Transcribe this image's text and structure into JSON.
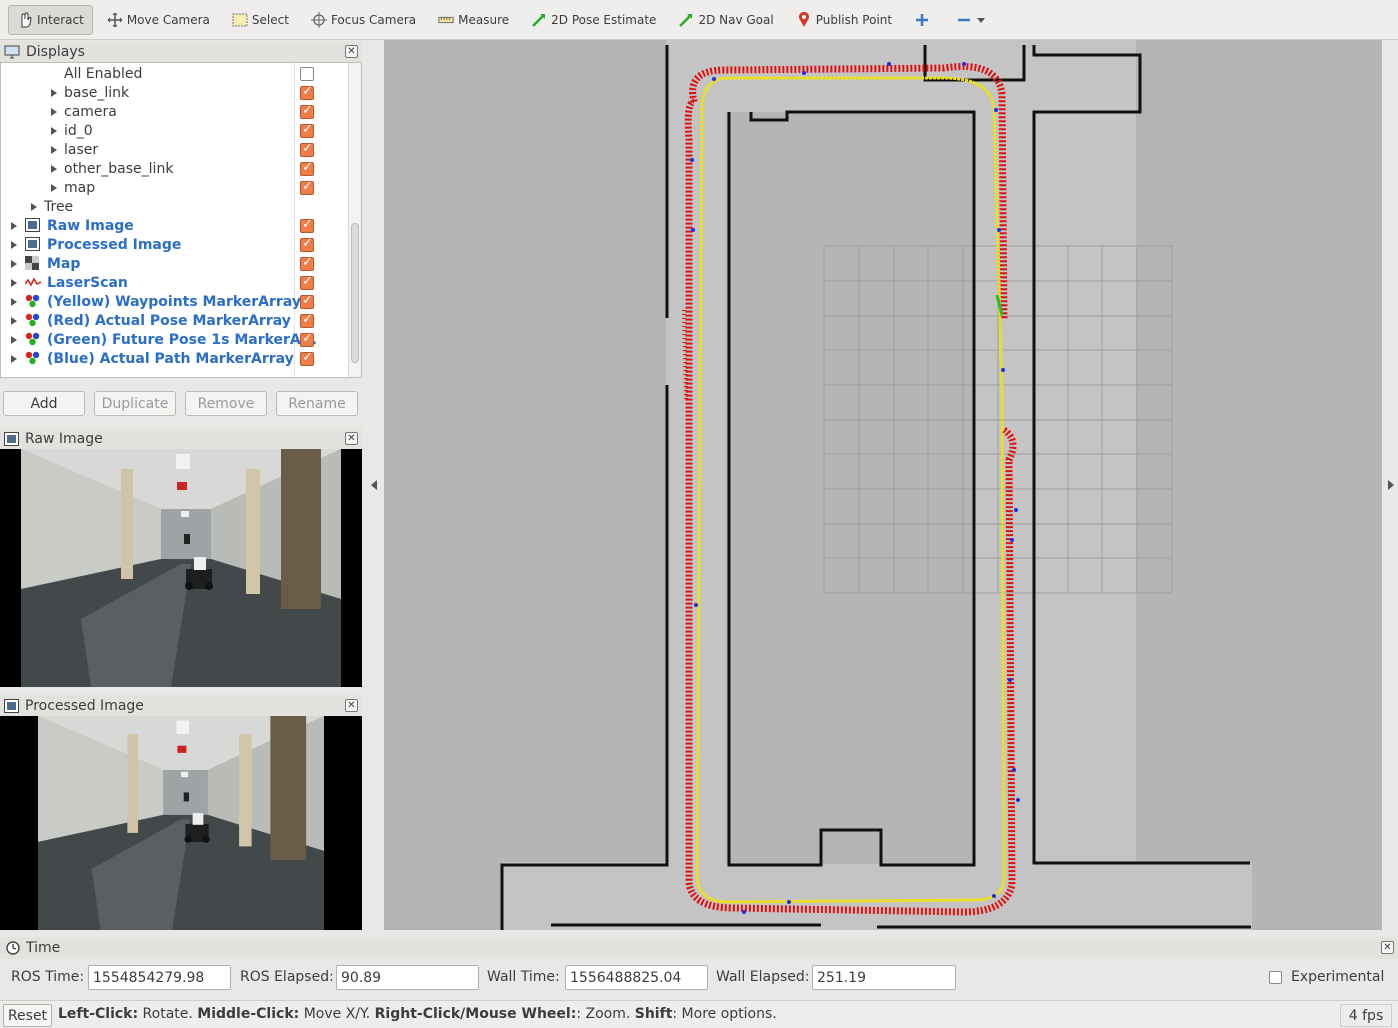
{
  "toolbar": {
    "interact": "Interact",
    "move_camera": "Move Camera",
    "select": "Select",
    "focus_camera": "Focus Camera",
    "measure": "Measure",
    "pose_estimate": "2D Pose Estimate",
    "nav_goal": "2D Nav Goal",
    "publish_point": "Publish Point"
  },
  "displays": {
    "title": "Displays",
    "items": [
      {
        "label": "All Enabled",
        "checked": false
      },
      {
        "label": "base_link",
        "checked": true
      },
      {
        "label": "camera",
        "checked": true
      },
      {
        "label": "id_0",
        "checked": true
      },
      {
        "label": "laser",
        "checked": true
      },
      {
        "label": "other_base_link",
        "checked": true
      },
      {
        "label": "map",
        "checked": true
      },
      {
        "label": "Tree"
      },
      {
        "label": "Raw Image",
        "checked": true,
        "icon": "image-icon"
      },
      {
        "label": "Processed Image",
        "checked": true,
        "icon": "image-icon"
      },
      {
        "label": "Map",
        "checked": true,
        "icon": "map-icon"
      },
      {
        "label": "LaserScan",
        "checked": true,
        "icon": "laserscan-icon"
      },
      {
        "label": "(Yellow) Waypoints MarkerArray",
        "checked": true,
        "icon": "marker-icon"
      },
      {
        "label": "(Red) Actual Pose MarkerArray",
        "checked": true,
        "icon": "marker-icon"
      },
      {
        "label": "(Green) Future Pose 1s MarkerA...",
        "checked": true,
        "icon": "marker-icon"
      },
      {
        "label": "(Blue) Actual Path MarkerArray",
        "checked": true,
        "icon": "marker-icon"
      }
    ],
    "buttons": {
      "add": "Add",
      "duplicate": "Duplicate",
      "remove": "Remove",
      "rename": "Rename"
    }
  },
  "raw_image": {
    "title": "Raw Image"
  },
  "processed_image": {
    "title": "Processed Image"
  },
  "time": {
    "title": "Time",
    "ros_time_label": "ROS Time:",
    "ros_time": "1554854279.98",
    "ros_elapsed_label": "ROS Elapsed:",
    "ros_elapsed": "90.89",
    "wall_time_label": "Wall Time:",
    "wall_time": "1556488825.04",
    "wall_elapsed_label": "Wall Elapsed:",
    "wall_elapsed": "251.19",
    "experimental": "Experimental"
  },
  "status": {
    "reset": "Reset",
    "hint_b1": "Left-Click:",
    "hint_t1": " Rotate. ",
    "hint_b2": "Middle-Click:",
    "hint_t2": " Move X/Y. ",
    "hint_b3": "Right-Click/Mouse Wheel:",
    "hint_t3": ": Zoom. ",
    "hint_b4": "Shift",
    "hint_t4": ": More options.",
    "fps": "4 fps"
  },
  "colors": {
    "checked": "#ef7d4a",
    "link_blue": "#2a6ec9",
    "waypoints": "#f2e600",
    "actual_pose": "#e01010",
    "actual_path": "#1e2ee0",
    "future_pose": "#22c022"
  }
}
